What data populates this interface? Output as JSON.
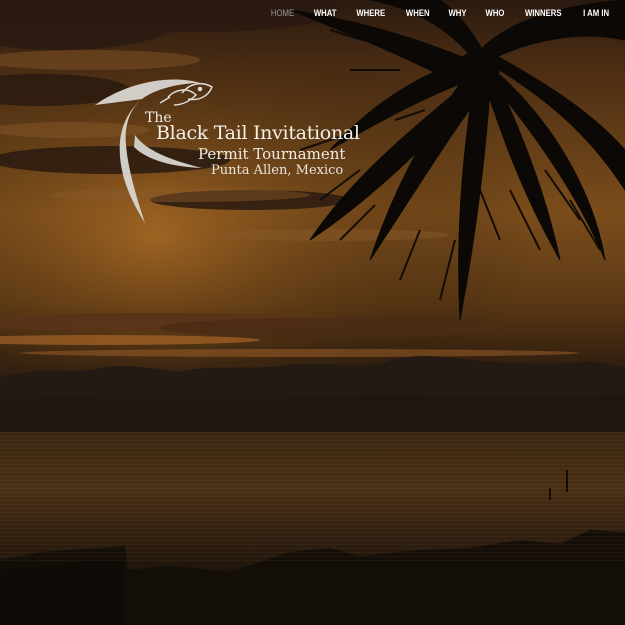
{
  "nav": {
    "items": [
      {
        "label": "HOME",
        "active": true
      },
      {
        "label": "WHAT"
      },
      {
        "label": "WHERE"
      },
      {
        "label": "WHEN"
      },
      {
        "label": "WHY"
      },
      {
        "label": "WHO"
      },
      {
        "label": "WINNERS"
      },
      {
        "label": "I AM IN"
      }
    ],
    "active_color": "#9a9a9a",
    "color": "#ffffff"
  },
  "logo": {
    "the": "The",
    "line1": "Black Tail Invitational",
    "line2": "Permit Tournament",
    "line3": "Punta Allen, Mexico",
    "icon": "permit-fish-logo-icon"
  },
  "hero": {
    "scene": "sunset-beach-palm"
  }
}
